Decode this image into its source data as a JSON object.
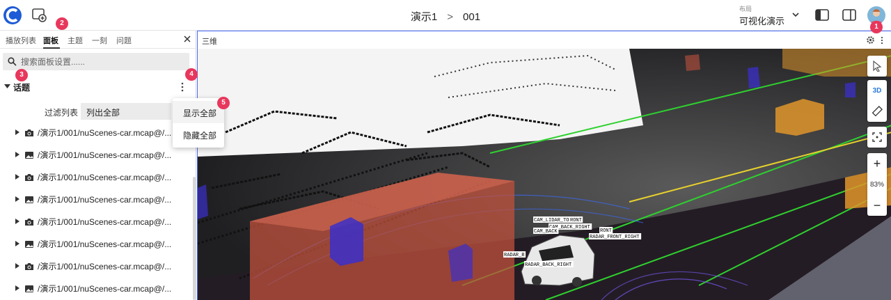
{
  "header": {
    "title": "演示1",
    "subtitle": "001",
    "layout_label": "布局",
    "layout_value": "可视化演示"
  },
  "badges": [
    "1",
    "2",
    "3",
    "4",
    "5"
  ],
  "sidebar": {
    "tabs": [
      "播放列表",
      "面板",
      "主题",
      "一刻",
      "问题"
    ],
    "active_tab": "面板",
    "search_placeholder": "搜索面板设置......",
    "section_title": "话题",
    "filter_label": "过滤列表",
    "filter_value": "列出全部",
    "topics": [
      {
        "icon": "camera-icon",
        "path": "/演示1/001/nuScenes-car.mcap@/..."
      },
      {
        "icon": "image-icon",
        "path": "/演示1/001/nuScenes-car.mcap@/..."
      },
      {
        "icon": "camera-icon",
        "path": "/演示1/001/nuScenes-car.mcap@/..."
      },
      {
        "icon": "image-icon",
        "path": "/演示1/001/nuScenes-car.mcap@/..."
      },
      {
        "icon": "camera-icon",
        "path": "/演示1/001/nuScenes-car.mcap@/..."
      },
      {
        "icon": "image-icon",
        "path": "/演示1/001/nuScenes-car.mcap@/..."
      },
      {
        "icon": "camera-icon",
        "path": "/演示1/001/nuScenes-car.mcap@/..."
      },
      {
        "icon": "image-icon",
        "path": "/演示1/001/nuScenes-car.mcap@/..."
      }
    ],
    "menu": [
      "显示全部",
      "隐藏全部"
    ]
  },
  "panel": {
    "title": "三维",
    "mode_3d": "3D",
    "zoom_in": "+",
    "zoom_out": "−",
    "zoom_level": "83%",
    "frame_labels": [
      "CAM_LIDAR_TOP",
      "RONT",
      "CAM_BACK_RIGHT",
      "CAM_BACK",
      "RONT",
      "RADAR_FRONT_RIGHT",
      "RADAR_B",
      "RADAR_BACK_RIGHT"
    ]
  },
  "colors": {
    "accent": "#4a6cf7",
    "badge": "#e8375c",
    "logo": "#1e5bd6",
    "box_red": "#c0503c",
    "box_orange": "#e0952a",
    "box_blue": "#3b2fc9",
    "lane_green": "#2fd12f",
    "lane_yellow": "#e9d22c"
  }
}
